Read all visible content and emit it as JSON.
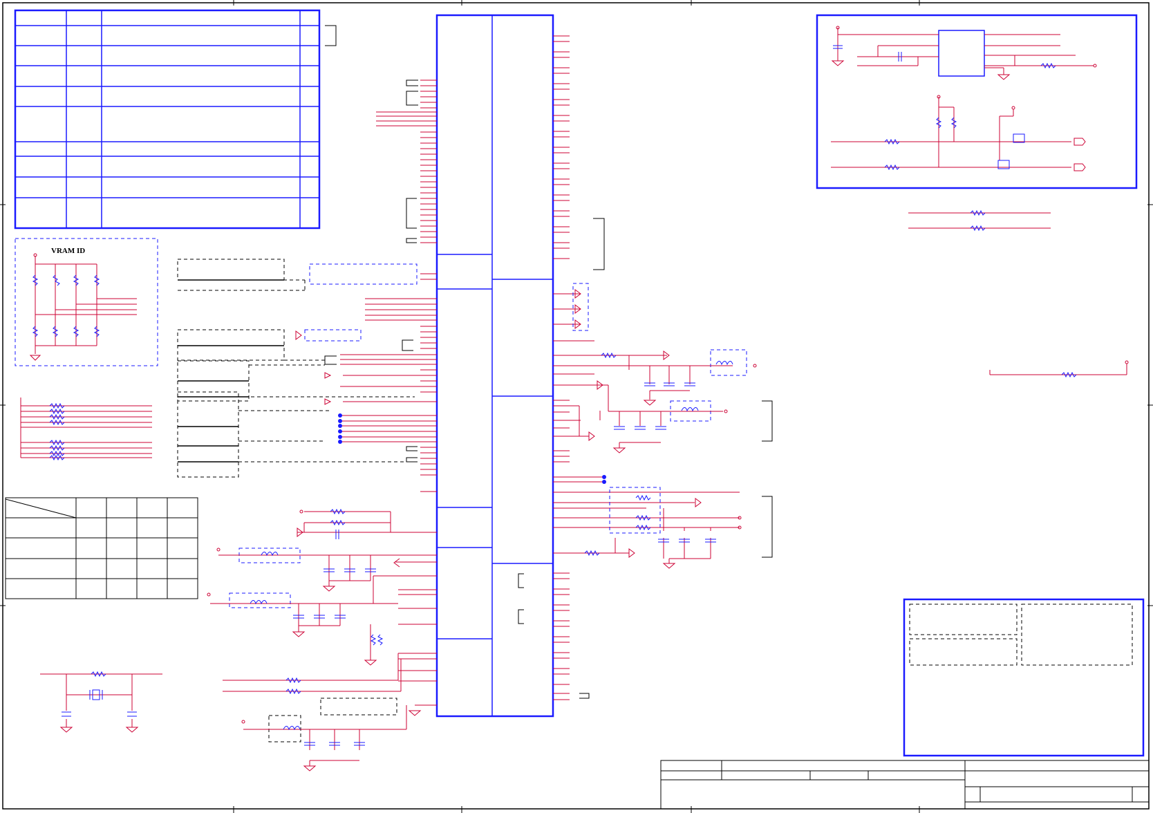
{
  "sheet": {
    "vram_block_label": "VRAM ID"
  },
  "colors": {
    "wire": "#cc0033",
    "net": "#7a003a",
    "block": "#1a1aff",
    "component": "#0000cc",
    "pin_end": "#cc0033",
    "dashed_group": "#000000",
    "frame": "#000000",
    "junction": "#c000c0"
  }
}
